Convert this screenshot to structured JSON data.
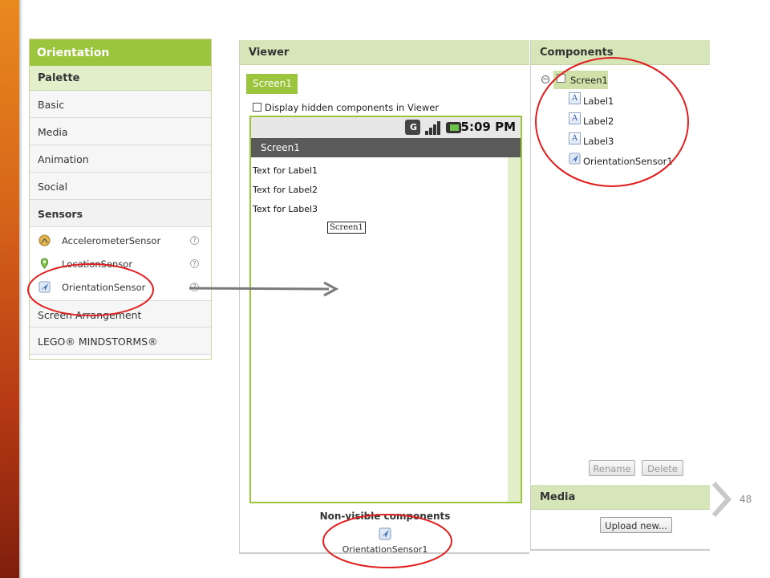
{
  "palette": {
    "title": "Orientation",
    "header": "Palette",
    "categories": [
      "Basic",
      "Media",
      "Animation",
      "Social"
    ],
    "sensors_label": "Sensors",
    "sensor_items": [
      {
        "label": "AccelerometerSensor",
        "icon": "accelerometer-icon"
      },
      {
        "label": "LocationSensor",
        "icon": "location-pin-icon"
      },
      {
        "label": "OrientationSensor",
        "icon": "orientation-icon"
      }
    ],
    "help_glyph": "?",
    "after_categories": [
      "Screen Arrangement",
      "LEGO® MINDSTORMS®"
    ]
  },
  "viewer": {
    "title": "Viewer",
    "screen_button": "Screen1",
    "hidden_checkbox_label": "Display hidden components in Viewer",
    "status_time": "5:09 PM",
    "screen_title": "Screen1",
    "labels": [
      "Text for Label1",
      "Text for Label2",
      "Text for Label3"
    ],
    "drop_tag": "Screen1",
    "nonvisible_title": "Non-visible components",
    "nonvisible_item": "OrientationSensor1"
  },
  "components": {
    "title": "Components",
    "root": "Screen1",
    "children": [
      "Label1",
      "Label2",
      "Label3",
      "OrientationSensor1"
    ],
    "rename_button": "Rename",
    "delete_button": "Delete"
  },
  "media": {
    "title": "Media",
    "upload_button": "Upload new..."
  },
  "slide": {
    "page_number": "48"
  },
  "colors": {
    "accent_green": "#9bc53d",
    "panel_header": "#d6e6b8",
    "annotation_red": "#e02020"
  }
}
